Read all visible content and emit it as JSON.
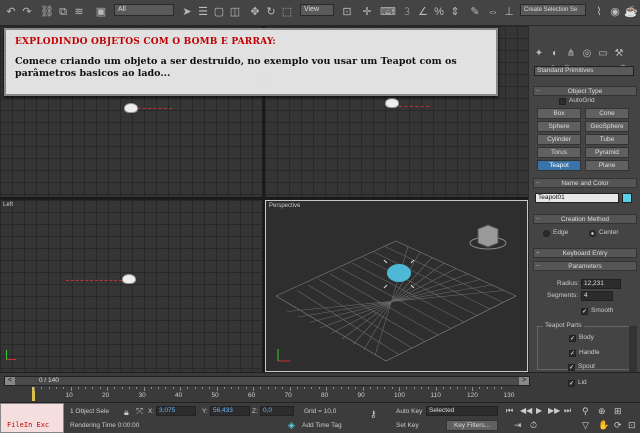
{
  "toolbar": {
    "filter_value": "All",
    "ref_coord_value": "View",
    "named_selection_value": "Create Selection Se"
  },
  "tutorial": {
    "title": "EXPLODINDO OBJETOS COM O BOMB E PARRAY:",
    "body": "Comece criando um objeto a ser destruido, no exemplo vou usar um Teapot com os parâmetros basicos ao lado..."
  },
  "viewports": {
    "left_label": "Left",
    "perspective_label": "Perspective"
  },
  "panel": {
    "category_dropdown": "Standard Primitives",
    "object_type_rollout": "Object Type",
    "autogrid_label": "AutoGrid",
    "primitives": [
      "Box",
      "Cone",
      "Sphere",
      "GeoSphere",
      "Cylinder",
      "Tube",
      "Torus",
      "Pyramid",
      "Teapot",
      "Plane"
    ],
    "name_color_rollout": "Name and Color",
    "object_name": "Teapot01",
    "object_color": "#5ad0e8",
    "creation_method_rollout": "Creation Method",
    "edge_label": "Edge",
    "center_label": "Center",
    "keyboard_entry_rollout": "Keyboard Entry",
    "parameters_rollout": "Parameters",
    "radius_label": "Radius:",
    "radius_value": "12,231",
    "segments_label": "Segments:",
    "segments_value": "4",
    "smooth_label": "Smooth",
    "teapot_parts_label": "Teapot Parts",
    "parts": [
      "Body",
      "Handle",
      "Spout",
      "Lid"
    ]
  },
  "timeline": {
    "frame_counter": "0 / 140",
    "ticks": [
      "10",
      "20",
      "30",
      "40",
      "50",
      "60",
      "70",
      "80",
      "90",
      "100",
      "110",
      "120",
      "130"
    ]
  },
  "status": {
    "script_listener": "FileIn Exc",
    "selection_text": "1 Object Sele",
    "x_label": "X:",
    "x_value": "3,075",
    "y_label": "Y:",
    "y_value": "56,433",
    "z_label": "Z:",
    "z_value": "0,0",
    "grid_text": "Grid = 10,0",
    "autokey_label": "Auto Key",
    "autokey_value": "Selected",
    "setkey_label": "Set Key",
    "key_filters_label": "Key Filters...",
    "rendering_time": "Rendering Time  0:00:00",
    "add_time_tag": "Add Time Tag"
  }
}
